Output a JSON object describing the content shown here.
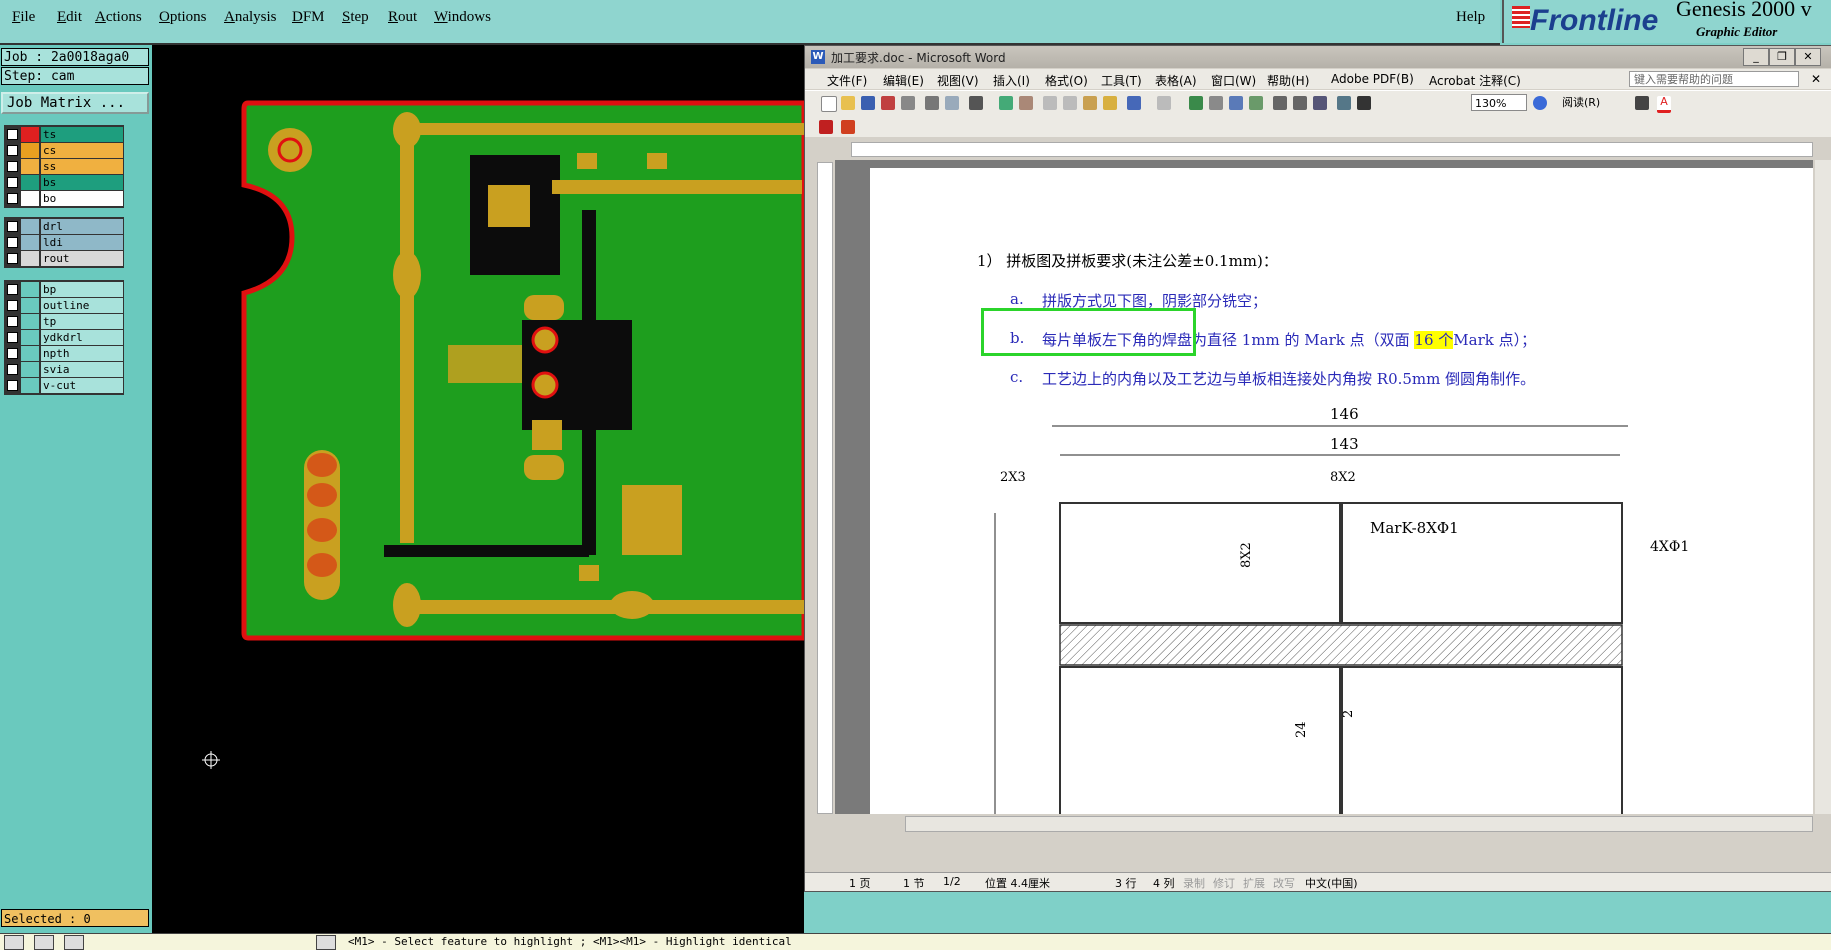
{
  "genesis": {
    "menu": [
      "File",
      "Edit",
      "Actions",
      "Options",
      "Analysis",
      "DFM",
      "Step",
      "Rout",
      "Windows"
    ],
    "help": "Help",
    "logo": {
      "brand": "Frontline",
      "product": "Genesis 2000",
      "suffix": "v",
      "subtitle": "Graphic Editor"
    },
    "job": "Job : 2a0018aga0",
    "step": "Step: cam",
    "job_matrix": "Job Matrix ...",
    "layers_group1": [
      {
        "name": "ts",
        "color": "#e02020",
        "bg": "#1e9e7e"
      },
      {
        "name": "cs",
        "color": "#e8a020",
        "bg": "#f0b040"
      },
      {
        "name": "ss",
        "color": "#f0b040",
        "bg": "#f0b040"
      },
      {
        "name": "bs",
        "color": "#1e9e7e",
        "bg": "#1e9e7e"
      },
      {
        "name": "bo",
        "color": "#ffffff",
        "bg": "#ffffff"
      }
    ],
    "layers_group2": [
      {
        "name": "drl",
        "color": "#8fb8c8",
        "bg": "#8fb8c8"
      },
      {
        "name": "ldi",
        "color": "#8fb8c8",
        "bg": "#8fb8c8"
      },
      {
        "name": "rout",
        "color": "#d8d8d8",
        "bg": "#d8d8d8"
      }
    ],
    "layers_group3": [
      {
        "name": "bp",
        "color": "#6ac9be",
        "bg": "#a8e2db"
      },
      {
        "name": "outline",
        "color": "#6ac9be",
        "bg": "#a8e2db"
      },
      {
        "name": "tp",
        "color": "#6ac9be",
        "bg": "#a8e2db"
      },
      {
        "name": "ydkdrl",
        "color": "#6ac9be",
        "bg": "#a8e2db"
      },
      {
        "name": "npth",
        "color": "#6ac9be",
        "bg": "#a8e2db"
      },
      {
        "name": "svia",
        "color": "#6ac9be",
        "bg": "#a8e2db"
      },
      {
        "name": "v-cut",
        "color": "#6ac9be",
        "bg": "#a8e2db"
      }
    ],
    "selected": "Selected : 0",
    "status": "<M1> - Select feature to highlight ; <M1><M1> - Highlight identical"
  },
  "word": {
    "title": "加工要求.doc - Microsoft Word",
    "menu": [
      "文件(F)",
      "编辑(E)",
      "视图(V)",
      "插入(I)",
      "格式(O)",
      "工具(T)",
      "表格(A)",
      "窗口(W)",
      "帮助(H)",
      "Adobe PDF(B)",
      "Acrobat 注释(C)"
    ],
    "help_placeholder": "键入需要帮助的问题",
    "zoom": "130%",
    "read_button": "阅读(R)",
    "doc": {
      "line1": "1）  拼板图及拼板要求(未注公差±0.1mm)：",
      "line_a_label": "a.",
      "line_a": "拼版方式见下图，阴影部分铣空；",
      "line_b_label": "b.",
      "line_b_part1": "每片单板左下角的焊盘为直径 1mm 的 Mark 点（双面 ",
      "line_b_hl": "16 个",
      "line_b_part2": "Mark 点）；",
      "line_c_label": "c.",
      "line_c": "工艺边上的内角以及工艺边与单板相连接处内角按 R0.5mm 倒圆角制作。",
      "dims": {
        "d146": "146",
        "d143": "143",
        "d2x3": "2X3",
        "d8x2": "8X2",
        "mark": "MarK-8XΦ1",
        "d4x1": "4XΦ1",
        "d8x2v": "8X2",
        "d24": "24",
        "d2": "2"
      }
    },
    "status": {
      "page": "1 页",
      "section": "1 节",
      "pages": "1/2",
      "pos": "位置 4.4厘米",
      "line": "3 行",
      "col": "4 列",
      "rec": "录制",
      "rev": "修订",
      "ext": "扩展",
      "ovr": "改写",
      "lang": "中文(中国)"
    }
  }
}
